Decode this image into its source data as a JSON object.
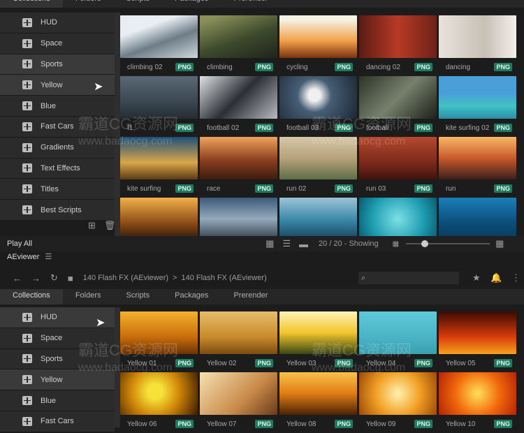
{
  "tabs": [
    "Collections",
    "Folders",
    "Scripts",
    "Packages",
    "Prerender"
  ],
  "top_sidebar": [
    "HUD",
    "Space",
    "Sports",
    "Yellow",
    "Blue",
    "Fast Cars",
    "Gradients",
    "Text Effects",
    "Titles",
    "Best Scripts"
  ],
  "top_grid": [
    {
      "label": "climbing 02",
      "badge": "PNG",
      "bg": "linear-gradient(160deg,#e8eef2 30%,#6d7d88 60%,#cfd6da)"
    },
    {
      "label": "climbing",
      "badge": "PNG",
      "bg": "linear-gradient(160deg,#8a8f5a 10%,#3d4a2c 55%,#20241b)"
    },
    {
      "label": "cycling",
      "badge": "PNG",
      "bg": "linear-gradient(180deg,#f5f1e6 10%,#f2a04a 60%,#7a3210)"
    },
    {
      "label": "dancing 02",
      "badge": "PNG",
      "bg": "linear-gradient(90deg,#5a1c14,#b83a26 50%,#6c2218)"
    },
    {
      "label": "dancing",
      "badge": "PNG",
      "bg": "linear-gradient(90deg,#e8e3dc,#c9c0b6 60%,#f3efe9)"
    },
    {
      "label": "f1",
      "badge": "PNG",
      "bg": "linear-gradient(180deg,#596875,#3b4752 60%,#262c31)"
    },
    {
      "label": "football 02",
      "badge": "PNG",
      "bg": "linear-gradient(135deg,#dfe1e4,#2b2f35 50%,#b8bcc2)"
    },
    {
      "label": "football 03",
      "badge": "PNG",
      "bg": "radial-gradient(circle at 45% 45%,#f0f0f0 12%,#465e74 35%,#1b2733)"
    },
    {
      "label": "football",
      "badge": "PNG",
      "bg": "linear-gradient(135deg,#2c3328,#77806d 50%,#1c2019)"
    },
    {
      "label": "kite surfing 02",
      "badge": "PNG",
      "bg": "linear-gradient(180deg,#4a9fd8 40%,#41c2c5 70%,#2b8fa6)"
    },
    {
      "label": "kite surfing",
      "badge": "PNG",
      "bg": "linear-gradient(180deg,#1d4f7a,#d9a74a 60%,#5b3a14)"
    },
    {
      "label": "race",
      "badge": "PNG",
      "bg": "linear-gradient(180deg,#f0a25a,#8a3f1f 55%,#3a1c0e)"
    },
    {
      "label": "run 02",
      "badge": "PNG",
      "bg": "linear-gradient(180deg,#d6c7a9,#b6a27b 50%,#5e6e48)"
    },
    {
      "label": "run 03",
      "badge": "PNG",
      "bg": "linear-gradient(180deg,#b4492f,#7c2a1c 60%,#3e130c)"
    },
    {
      "label": "run",
      "badge": "PNG",
      "bg": "linear-gradient(180deg,#f8b865,#c95a2c 50%,#3b1e1c)"
    },
    {
      "label": "",
      "badge": "",
      "bg": "linear-gradient(180deg,#f3b04a,#8b4b16 60%,#2a170c)"
    },
    {
      "label": "",
      "badge": "",
      "bg": "linear-gradient(180deg,#3d5a78,#95a9bb 50%,#2d3b48)"
    },
    {
      "label": "",
      "badge": "",
      "bg": "linear-gradient(180deg,#9cc3d8,#3e8bab 50%,#15405a)"
    },
    {
      "label": "",
      "badge": "",
      "bg": "radial-gradient(circle,#7de0e6,#1d9bb0 60%,#0c5a6c)"
    },
    {
      "label": "",
      "badge": "",
      "bg": "linear-gradient(180deg,#1a7fb8,#0b4d78 60%,#0a3a5a)"
    }
  ],
  "toolbar": {
    "play_all": "Play All",
    "showing": "20 / 20 - Showing"
  },
  "aeviewer": {
    "title": "AEviewer",
    "breadcrumb_1": "140 Flash FX (AEviewer)",
    "separator": ">",
    "breadcrumb_2": "140 Flash FX (AEviewer)",
    "search_placeholder": ""
  },
  "bottom_sidebar": [
    "HUD",
    "Space",
    "Sports",
    "Yellow",
    "Blue",
    "Fast Cars"
  ],
  "bottom_grid": [
    {
      "label": "Yellow 01",
      "badge": "PNG",
      "bg": "linear-gradient(180deg,#f5b12c,#c96d0c 60%,#6b3306)"
    },
    {
      "label": "Yellow 02",
      "badge": "PNG",
      "bg": "linear-gradient(180deg,#e6bd6b,#c98a2b 60%,#7a4b12)"
    },
    {
      "label": "Yellow 03",
      "badge": "PNG",
      "bg": "linear-gradient(180deg,#fff3b8,#f2c52c 50%,#3b4616)"
    },
    {
      "label": "Yellow 04",
      "badge": "PNG",
      "bg": "linear-gradient(180deg,#5fc9d8,#4ab3c5 60%,#3aa0b0)"
    },
    {
      "label": "Yellow 05",
      "badge": "PNG",
      "bg": "linear-gradient(180deg,#3b0a02,#d93c0c 60%,#f5a21c)"
    },
    {
      "label": "Yellow 06",
      "badge": "PNG",
      "bg": "radial-gradient(circle at 45% 45%,#f7e23a 15%,#d08608 50%,#3a1a02)"
    },
    {
      "label": "Yellow 07",
      "badge": "PNG",
      "bg": "linear-gradient(135deg,#f6e0b0,#c98a4a 60%,#6a3a1a)"
    },
    {
      "label": "Yellow 08",
      "badge": "PNG",
      "bg": "linear-gradient(180deg,#f8c24a,#e07c14 50%,#4a2208)"
    },
    {
      "label": "Yellow 09",
      "badge": "PNG",
      "bg": "radial-gradient(circle,#fff2b0,#f2a024 50%,#9c4a06)"
    },
    {
      "label": "Yellow 10",
      "badge": "PNG",
      "bg": "radial-gradient(circle,#ffe15a,#f26a0c 50%,#b42206)"
    }
  ],
  "watermark": {
    "line1": "霸道CG资源网",
    "line2": "www.badaocg.com"
  }
}
